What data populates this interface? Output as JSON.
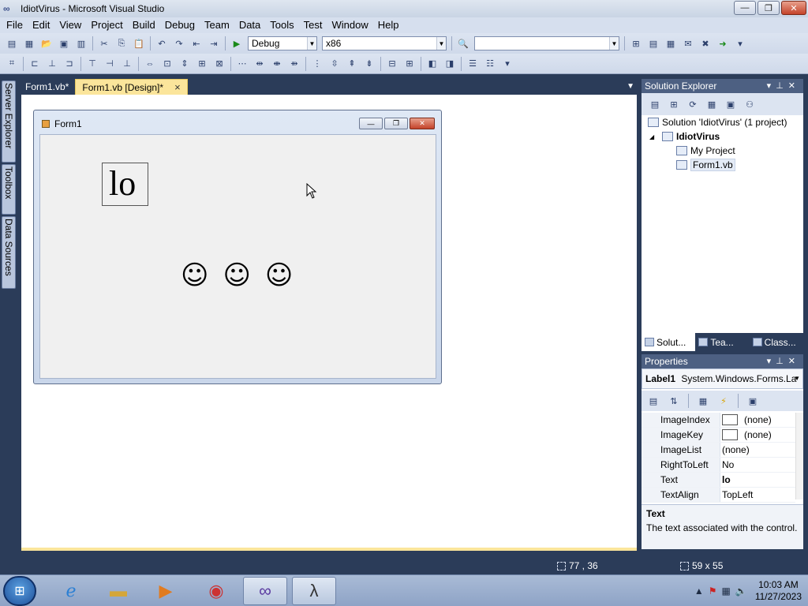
{
  "window": {
    "title": "IdiotVirus - Microsoft Visual Studio",
    "icon": "infinity-icon",
    "controls": [
      "minimize",
      "maximize",
      "close"
    ]
  },
  "menu": [
    "File",
    "Edit",
    "View",
    "Project",
    "Build",
    "Debug",
    "Team",
    "Data",
    "Tools",
    "Test",
    "Window",
    "Help"
  ],
  "toolbar": {
    "config_value": "Debug",
    "platform_value": "x86",
    "find_value": ""
  },
  "side_tabs": [
    "Server Explorer",
    "Toolbox",
    "Data Sources"
  ],
  "doc_tabs": [
    {
      "label": "Form1.vb*",
      "active": false
    },
    {
      "label": "Form1.vb [Design]*",
      "active": true,
      "close": "×"
    }
  ],
  "form": {
    "title": "Form1",
    "label_text": "lo",
    "smileys": [
      "☺",
      "☺",
      "☺"
    ]
  },
  "solution_explorer": {
    "title": "Solution Explorer",
    "tree": [
      {
        "label": "Solution 'IdiotVirus' (1 project)",
        "bold": false,
        "indent": 0
      },
      {
        "label": "IdiotVirus",
        "bold": true,
        "indent": 1,
        "expander": "◢"
      },
      {
        "label": "My Project",
        "bold": false,
        "indent": 2
      },
      {
        "label": "Form1.vb",
        "bold": false,
        "indent": 2,
        "selected": true
      }
    ],
    "tabs": [
      "Solut...",
      "Tea...",
      "Class..."
    ]
  },
  "properties": {
    "title": "Properties",
    "object_name": "Label1",
    "object_type": "System.Windows.Forms.La",
    "rows": [
      {
        "name": "ImageIndex",
        "value": "(none)",
        "swatch": true
      },
      {
        "name": "ImageKey",
        "value": "(none)",
        "swatch": true
      },
      {
        "name": "ImageList",
        "value": "(none)"
      },
      {
        "name": "RightToLeft",
        "value": "No"
      },
      {
        "name": "Text",
        "value": "lo",
        "bold": true
      },
      {
        "name": "TextAlign",
        "value": "TopLeft"
      }
    ],
    "desc_title": "Text",
    "desc_text": "The text associated with the control."
  },
  "status": {
    "position": "77 , 36",
    "size": "59 x 55"
  },
  "taskbar": {
    "time": "10:03 AM",
    "date": "11/27/2023"
  },
  "colors": {
    "accent": "#fbe59b",
    "chrome_dark": "#2b3c59",
    "panel_head": "#4d6082"
  }
}
